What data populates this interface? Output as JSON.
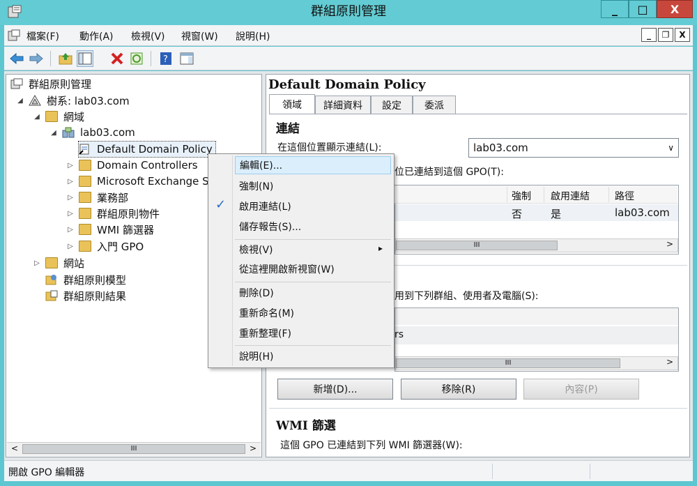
{
  "window": {
    "title": "群組原則管理",
    "min_glyph": "_",
    "max_glyph": "□",
    "close_glyph": "X"
  },
  "menubar": {
    "items": [
      "檔案(F)",
      "動作(A)",
      "檢視(V)",
      "視窗(W)",
      "說明(H)"
    ],
    "mdi_min": "_",
    "mdi_restore": "❐",
    "mdi_close": "X"
  },
  "tree": {
    "root": "群組原則管理",
    "forest": "樹系: lab03.com",
    "domains": "網域",
    "domain": "lab03.com",
    "default_policy": "Default Domain Policy",
    "children": [
      "Domain Controllers",
      "Microsoft Exchange S",
      "業務部",
      "群組原則物件",
      "WMI 篩選器",
      "入門 GPO"
    ],
    "sites": "網站",
    "modeling": "群組原則模型",
    "results": "群組原則結果",
    "hscroll_thumb": "III"
  },
  "right": {
    "heading": "Default Domain Policy",
    "tabs": [
      "領域",
      "詳細資料",
      "設定",
      "委派"
    ],
    "links_title": "連結",
    "links_show_label": "在這個位置顯示連結(L):",
    "links_location": "lab03.com",
    "links_linked_label": "位已連結到這個 GPO(T):",
    "links_columns": [
      "強制",
      "啟用連結",
      "路徑"
    ],
    "links_row": {
      "enforced": "否",
      "enabled": "是",
      "path": "lab03.com"
    },
    "scroll_thumb": "III",
    "security_label": "用到下列群組、使用者及電腦(S):",
    "security_row_partial": "rs",
    "buttons": {
      "add": "新增(D)...",
      "remove": "移除(R)",
      "properties": "內容(P)"
    },
    "wmi_title": "WMI 篩選",
    "wmi_label": "這個 GPO 已連結到下列 WMI 篩選器(W):"
  },
  "context_menu": {
    "items": [
      "編輯(E)...",
      "強制(N)",
      "啟用連結(L)",
      "儲存報告(S)...",
      "檢視(V)",
      "從這裡開啟新視窗(W)",
      "刪除(D)",
      "重新命名(M)",
      "重新整理(F)",
      "說明(H)"
    ],
    "check": "✓",
    "submenu_arrow": "▸"
  },
  "status": {
    "text": "開啟 GPO 編輯器"
  },
  "colors": {
    "titlebar": "#63cbd3",
    "close": "#c8473c",
    "highlight": "#dbeefb"
  }
}
